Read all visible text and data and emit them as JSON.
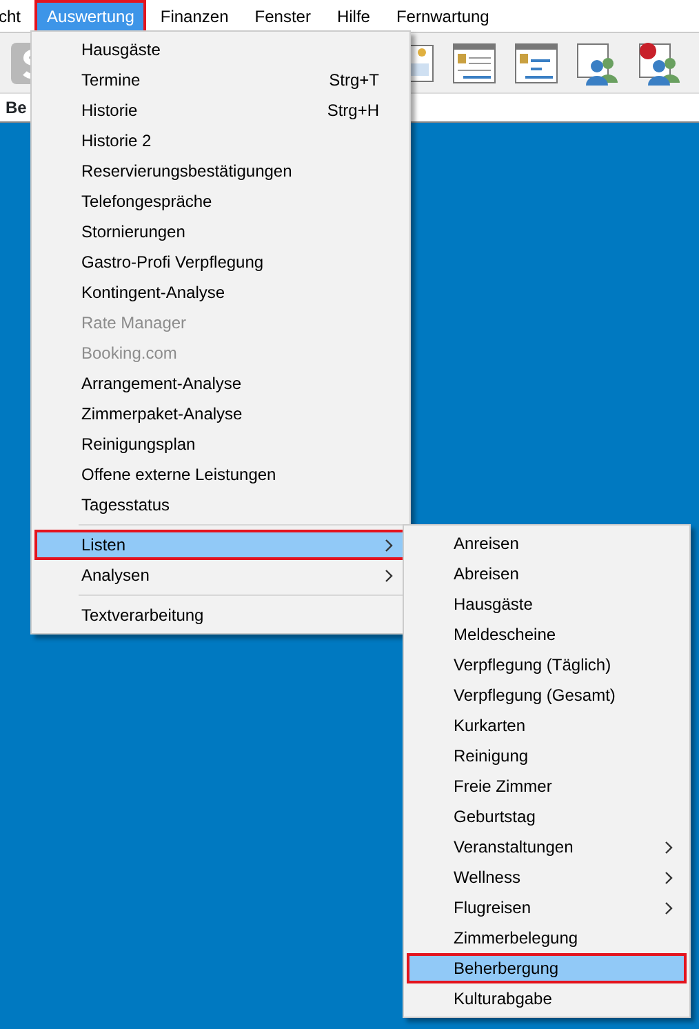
{
  "menu_bar": [
    {
      "label": "cht",
      "selected": false,
      "outlined": false
    },
    {
      "label": "Auswertung",
      "selected": true,
      "outlined": true
    },
    {
      "label": "Finanzen",
      "selected": false,
      "outlined": false
    },
    {
      "label": "Fenster",
      "selected": false,
      "outlined": false
    },
    {
      "label": "Hilfe",
      "selected": false,
      "outlined": false
    },
    {
      "label": "Fernwartung",
      "selected": false,
      "outlined": false
    }
  ],
  "tab_strip": {
    "label": "Be"
  },
  "menu": [
    {
      "kind": "item",
      "label": "Hausgäste",
      "disabled": false,
      "selected": false,
      "outlined": false,
      "submenu": false
    },
    {
      "kind": "item",
      "label": "Termine",
      "shortcut": "Strg+T",
      "disabled": false,
      "selected": false,
      "outlined": false,
      "submenu": false
    },
    {
      "kind": "item",
      "label": "Historie",
      "shortcut": "Strg+H",
      "disabled": false,
      "selected": false,
      "outlined": false,
      "submenu": false
    },
    {
      "kind": "item",
      "label": "Historie 2",
      "disabled": false,
      "selected": false,
      "outlined": false,
      "submenu": false
    },
    {
      "kind": "item",
      "label": "Reservierungsbestätigungen",
      "disabled": false,
      "selected": false,
      "outlined": false,
      "submenu": false
    },
    {
      "kind": "item",
      "label": "Telefongespräche",
      "disabled": false,
      "selected": false,
      "outlined": false,
      "submenu": false
    },
    {
      "kind": "item",
      "label": "Stornierungen",
      "disabled": false,
      "selected": false,
      "outlined": false,
      "submenu": false
    },
    {
      "kind": "item",
      "label": "Gastro-Profi Verpflegung",
      "disabled": false,
      "selected": false,
      "outlined": false,
      "submenu": false
    },
    {
      "kind": "item",
      "label": "Kontingent-Analyse",
      "disabled": false,
      "selected": false,
      "outlined": false,
      "submenu": false
    },
    {
      "kind": "item",
      "label": "Rate Manager",
      "disabled": true,
      "selected": false,
      "outlined": false,
      "submenu": false
    },
    {
      "kind": "item",
      "label": "Booking.com",
      "disabled": true,
      "selected": false,
      "outlined": false,
      "submenu": false
    },
    {
      "kind": "item",
      "label": "Arrangement-Analyse",
      "disabled": false,
      "selected": false,
      "outlined": false,
      "submenu": false
    },
    {
      "kind": "item",
      "label": "Zimmerpaket-Analyse",
      "disabled": false,
      "selected": false,
      "outlined": false,
      "submenu": false
    },
    {
      "kind": "item",
      "label": "Reinigungsplan",
      "disabled": false,
      "selected": false,
      "outlined": false,
      "submenu": false
    },
    {
      "kind": "item",
      "label": "Offene externe Leistungen",
      "disabled": false,
      "selected": false,
      "outlined": false,
      "submenu": false
    },
    {
      "kind": "item",
      "label": "Tagesstatus",
      "disabled": false,
      "selected": false,
      "outlined": false,
      "submenu": false
    },
    {
      "kind": "separator"
    },
    {
      "kind": "item",
      "label": "Listen",
      "disabled": false,
      "selected": true,
      "outlined": true,
      "submenu": true
    },
    {
      "kind": "item",
      "label": "Analysen",
      "disabled": false,
      "selected": false,
      "outlined": false,
      "submenu": true
    },
    {
      "kind": "separator"
    },
    {
      "kind": "item",
      "label": "Textverarbeitung",
      "disabled": false,
      "selected": false,
      "outlined": false,
      "submenu": false
    }
  ],
  "submenu": [
    {
      "kind": "item",
      "label": "Anreisen",
      "selected": false,
      "outlined": false,
      "submenu": false
    },
    {
      "kind": "item",
      "label": "Abreisen",
      "selected": false,
      "outlined": false,
      "submenu": false
    },
    {
      "kind": "item",
      "label": "Hausgäste",
      "selected": false,
      "outlined": false,
      "submenu": false
    },
    {
      "kind": "item",
      "label": "Meldescheine",
      "selected": false,
      "outlined": false,
      "submenu": false
    },
    {
      "kind": "item",
      "label": "Verpflegung (Täglich)",
      "selected": false,
      "outlined": false,
      "submenu": false
    },
    {
      "kind": "item",
      "label": "Verpflegung (Gesamt)",
      "selected": false,
      "outlined": false,
      "submenu": false
    },
    {
      "kind": "item",
      "label": "Kurkarten",
      "selected": false,
      "outlined": false,
      "submenu": false
    },
    {
      "kind": "item",
      "label": "Reinigung",
      "selected": false,
      "outlined": false,
      "submenu": false
    },
    {
      "kind": "item",
      "label": "Freie Zimmer",
      "selected": false,
      "outlined": false,
      "submenu": false
    },
    {
      "kind": "item",
      "label": "Geburtstag",
      "selected": false,
      "outlined": false,
      "submenu": false
    },
    {
      "kind": "item",
      "label": "Veranstaltungen",
      "selected": false,
      "outlined": false,
      "submenu": true
    },
    {
      "kind": "item",
      "label": "Wellness",
      "selected": false,
      "outlined": false,
      "submenu": true
    },
    {
      "kind": "item",
      "label": "Flugreisen",
      "selected": false,
      "outlined": false,
      "submenu": true
    },
    {
      "kind": "item",
      "label": "Zimmerbelegung",
      "selected": false,
      "outlined": false,
      "submenu": false
    },
    {
      "kind": "item",
      "label": "Beherbergung",
      "selected": true,
      "outlined": true,
      "submenu": false
    },
    {
      "kind": "item",
      "label": "Kulturabgabe",
      "selected": false,
      "outlined": false,
      "submenu": false
    }
  ]
}
